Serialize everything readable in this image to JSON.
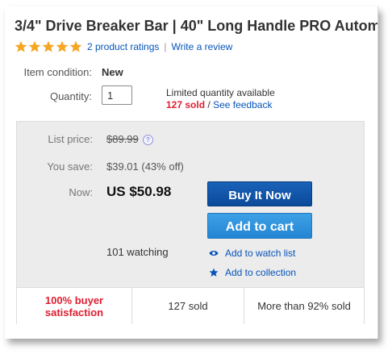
{
  "listing": {
    "title": "3/4\" Drive Breaker Bar | 40\" Long Handle PRO Autom",
    "rating": {
      "stars": 5,
      "ratings_text": "2 product ratings",
      "write_review": "Write a review"
    },
    "item_condition": {
      "label": "Item condition:",
      "value": "New"
    },
    "quantity": {
      "label": "Quantity:",
      "value": "1",
      "limited_text": "Limited quantity available",
      "sold_text": "127 sold",
      "separator": "/",
      "feedback_link": "See feedback"
    }
  },
  "pricing": {
    "list_price": {
      "label": "List price:",
      "value": "$89.99"
    },
    "you_save": {
      "label": "You save:",
      "value": "$39.01 (43% off)"
    },
    "now": {
      "label": "Now:",
      "value": "US $50.98"
    },
    "buy_it_now": "Buy It Now",
    "add_to_cart": "Add to cart",
    "watching": "101 watching",
    "add_to_watch_list": "Add to watch list",
    "add_to_collection": "Add to collection"
  },
  "stats": {
    "satisfaction_line1": "100% buyer",
    "satisfaction_line2": "satisfaction",
    "sold": "127 sold",
    "sold_percent": "More than 92% sold"
  },
  "colors": {
    "link": "#0654ba",
    "star": "#f5a623",
    "accent_red": "#dd1e31",
    "buy_button": "#0a4a9a",
    "cart_button": "#2385d3"
  },
  "icons": [
    "star-icon",
    "help-icon",
    "eye-icon",
    "star-collection-icon"
  ]
}
